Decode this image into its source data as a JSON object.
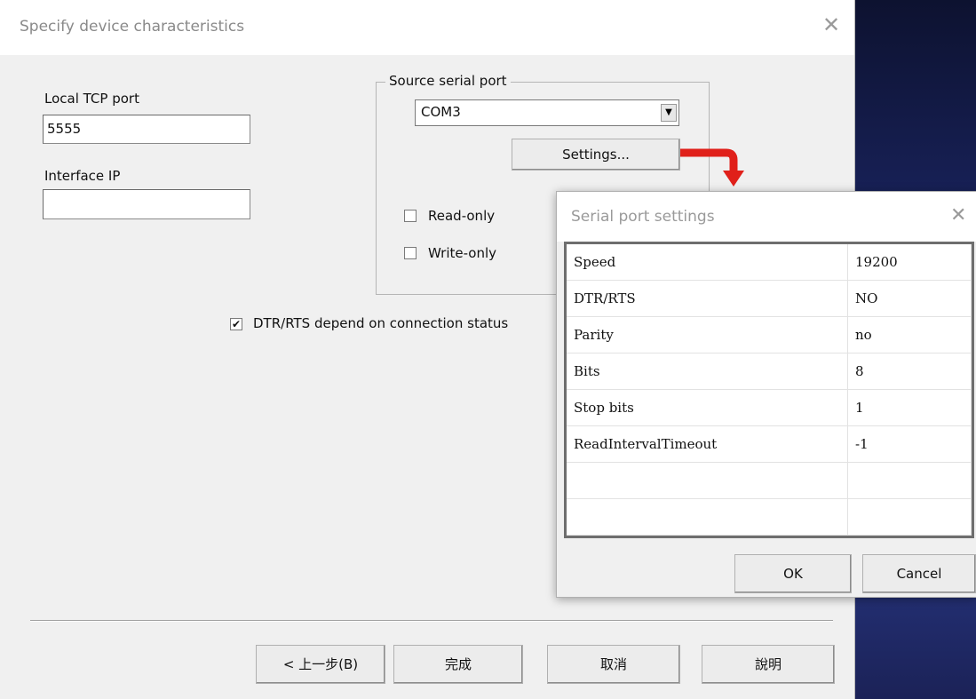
{
  "main_dialog": {
    "title": "Specify device characteristics",
    "close_glyph": "✕",
    "local_tcp_port_label": "Local TCP port",
    "local_tcp_port_value": "5555",
    "interface_ip_label": "Interface IP",
    "interface_ip_value": "",
    "source_group_label": "Source serial port",
    "port_select_value": "COM3",
    "settings_button": "Settings...",
    "read_only_label": "Read-only",
    "read_only_checked": false,
    "write_only_label": "Write-only",
    "write_only_checked": false,
    "dtr_rts_label": "DTR/RTS depend on connection status",
    "dtr_rts_checked": true,
    "buttons": {
      "back": "< 上一步(B)",
      "finish": "完成",
      "cancel": "取消",
      "help": "說明"
    }
  },
  "serial_dialog": {
    "title": "Serial port settings",
    "close_glyph": "✕",
    "rows": [
      {
        "name": "Speed",
        "value": "19200"
      },
      {
        "name": "DTR/RTS",
        "value": "NO"
      },
      {
        "name": "Parity",
        "value": "no"
      },
      {
        "name": "Bits",
        "value": "8"
      },
      {
        "name": "Stop bits",
        "value": "1"
      },
      {
        "name": "ReadIntervalTimeout",
        "value": "-1"
      },
      {
        "name": "",
        "value": ""
      },
      {
        "name": "",
        "value": ""
      }
    ],
    "ok_button": "OK",
    "cancel_button": "Cancel"
  },
  "colors": {
    "arrow": "#e0201a",
    "desktop": "#1a2460"
  }
}
